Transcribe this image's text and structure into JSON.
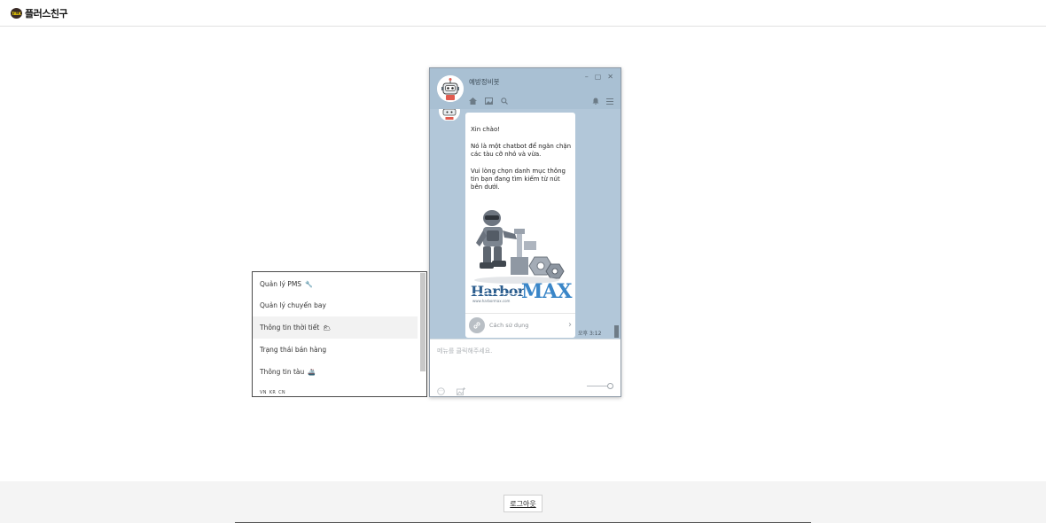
{
  "header": {
    "badge_text": "TALK",
    "brand_name": "플러스친구"
  },
  "chat": {
    "bot_name": "예방정비봇",
    "window_controls": [
      "–",
      "▢",
      "✕"
    ],
    "messages": {
      "greeting": "Xin chào!",
      "intro": "Nó là một chatbot để ngăn chặn các tàu cỡ nhỏ và vừa.",
      "instruction": "Vui lòng chọn danh mục thông tin bạn đang tìm kiếm từ nút bên dưới."
    },
    "logo": {
      "harbor": "Harbor",
      "max": "MAX",
      "url": "www.harbormax.com"
    },
    "link_button_label": "Cách sử dụng",
    "time": "오후 3:12",
    "input_placeholder": "메뉴를 클릭해주세요."
  },
  "menu": {
    "items": [
      {
        "label": "Quản lý PMS",
        "emoji": "🔧"
      },
      {
        "label": "Quản lý chuyến bay",
        "emoji": ""
      },
      {
        "label": "Thông tin thời tiết",
        "emoji": "🌥"
      },
      {
        "label": "Trạng thái bán hàng",
        "emoji": ""
      },
      {
        "label": "Thông tin tàu",
        "emoji": "🚢"
      }
    ],
    "highlighted_index": 2,
    "languages": [
      "VN",
      "KR",
      "CN"
    ]
  },
  "footer": {
    "logout_label": "로그아웃"
  },
  "colors": {
    "chat_background": "#b2c7d9",
    "header_background": "#a9c0d3",
    "logo_blue": "#3a86c8"
  },
  "icons": [
    "home-icon",
    "image-icon",
    "search-icon",
    "bell-icon",
    "menu-icon",
    "link-icon",
    "chevron-right-icon",
    "emoji-icon",
    "add-image-icon",
    "robot-avatar-icon"
  ]
}
